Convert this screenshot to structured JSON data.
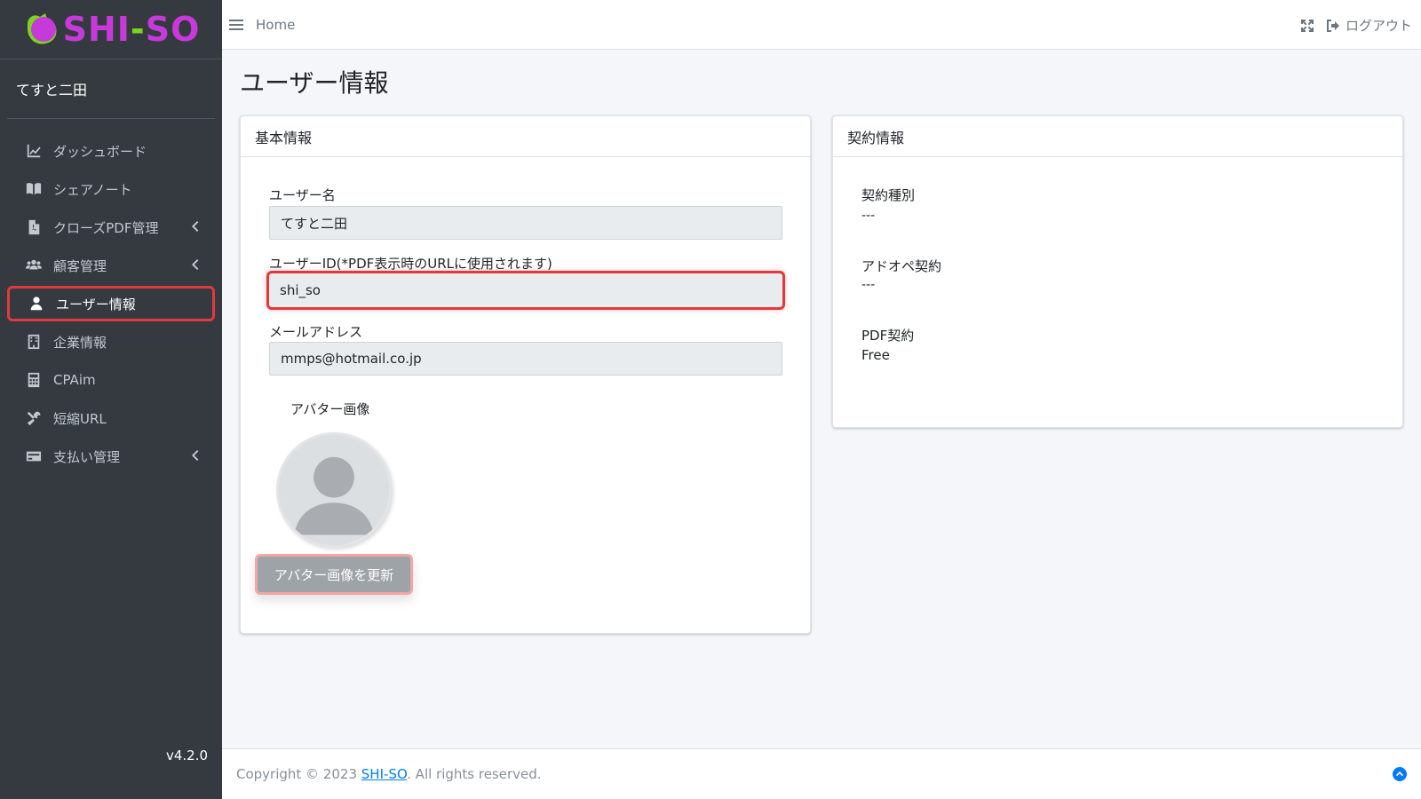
{
  "brand": {
    "part1": "SHI",
    "dash": "-",
    "part2": "SO",
    "colors": {
      "pink": "#c53ad9",
      "green": "#7ed321"
    }
  },
  "user_panel": {
    "name": "てすと二田"
  },
  "sidebar": {
    "items": [
      {
        "label": "ダッシュボード",
        "icon": "chart-line-icon",
        "submenu": false
      },
      {
        "label": "シェアノート",
        "icon": "book-open-icon",
        "submenu": false
      },
      {
        "label": "クローズPDF管理",
        "icon": "file-pdf-icon",
        "submenu": true
      },
      {
        "label": "顧客管理",
        "icon": "users-icon",
        "submenu": true
      },
      {
        "label": "ユーザー情報",
        "icon": "user-icon",
        "submenu": false,
        "active": true
      },
      {
        "label": "企業情報",
        "icon": "building-icon",
        "submenu": false
      },
      {
        "label": "CPAim",
        "icon": "calculator-icon",
        "submenu": false
      },
      {
        "label": "短縮URL",
        "icon": "tools-icon",
        "submenu": false
      },
      {
        "label": "支払い管理",
        "icon": "credit-card-icon",
        "submenu": true
      }
    ],
    "version": "v4.2.0"
  },
  "header": {
    "home_label": "Home",
    "logout_label": "ログアウト"
  },
  "page": {
    "title": "ユーザー情報"
  },
  "basic": {
    "title": "基本情報",
    "username_label": "ユーザー名",
    "username_value": "てすと二田",
    "userid_label": "ユーザーID(*PDF表示時のURLに使用されます)",
    "userid_value": "shi_so",
    "email_label": "メールアドレス",
    "email_value": "mmps@hotmail.co.jp",
    "avatar_label": "アバター画像",
    "avatar_button": "アバター画像を更新"
  },
  "contract": {
    "title": "契約情報",
    "type_label": "契約種別",
    "type_value": "---",
    "adope_label": "アドオペ契約",
    "adope_value": "---",
    "pdf_label": "PDF契約",
    "pdf_value": "Free"
  },
  "footer": {
    "prefix": "Copyright © 2023 ",
    "link": "SHI-SO",
    "suffix": ". All rights reserved."
  },
  "colors": {
    "sidebar_bg": "#343a40",
    "highlight": "#e03a3e",
    "link": "#007bff"
  }
}
